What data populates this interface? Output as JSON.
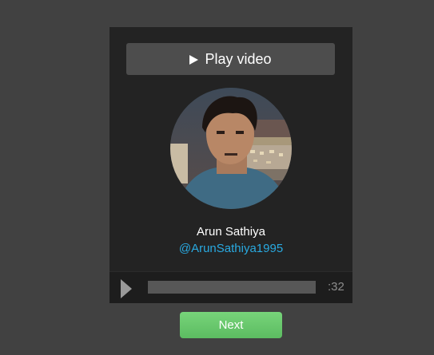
{
  "card": {
    "play_video_label": "Play video",
    "profile": {
      "name": "Arun Sathiya",
      "handle": "@ArunSathiya1995"
    },
    "player": {
      "duration": ":32",
      "progress": 0
    }
  },
  "footer": {
    "next_label": "Next"
  },
  "colors": {
    "page_background": "#414141",
    "card_background": "#232323",
    "link": "#29a9e0",
    "next_button": "#6ac96e"
  },
  "icons": {
    "play_video": "play-icon",
    "player_play": "play-icon"
  }
}
